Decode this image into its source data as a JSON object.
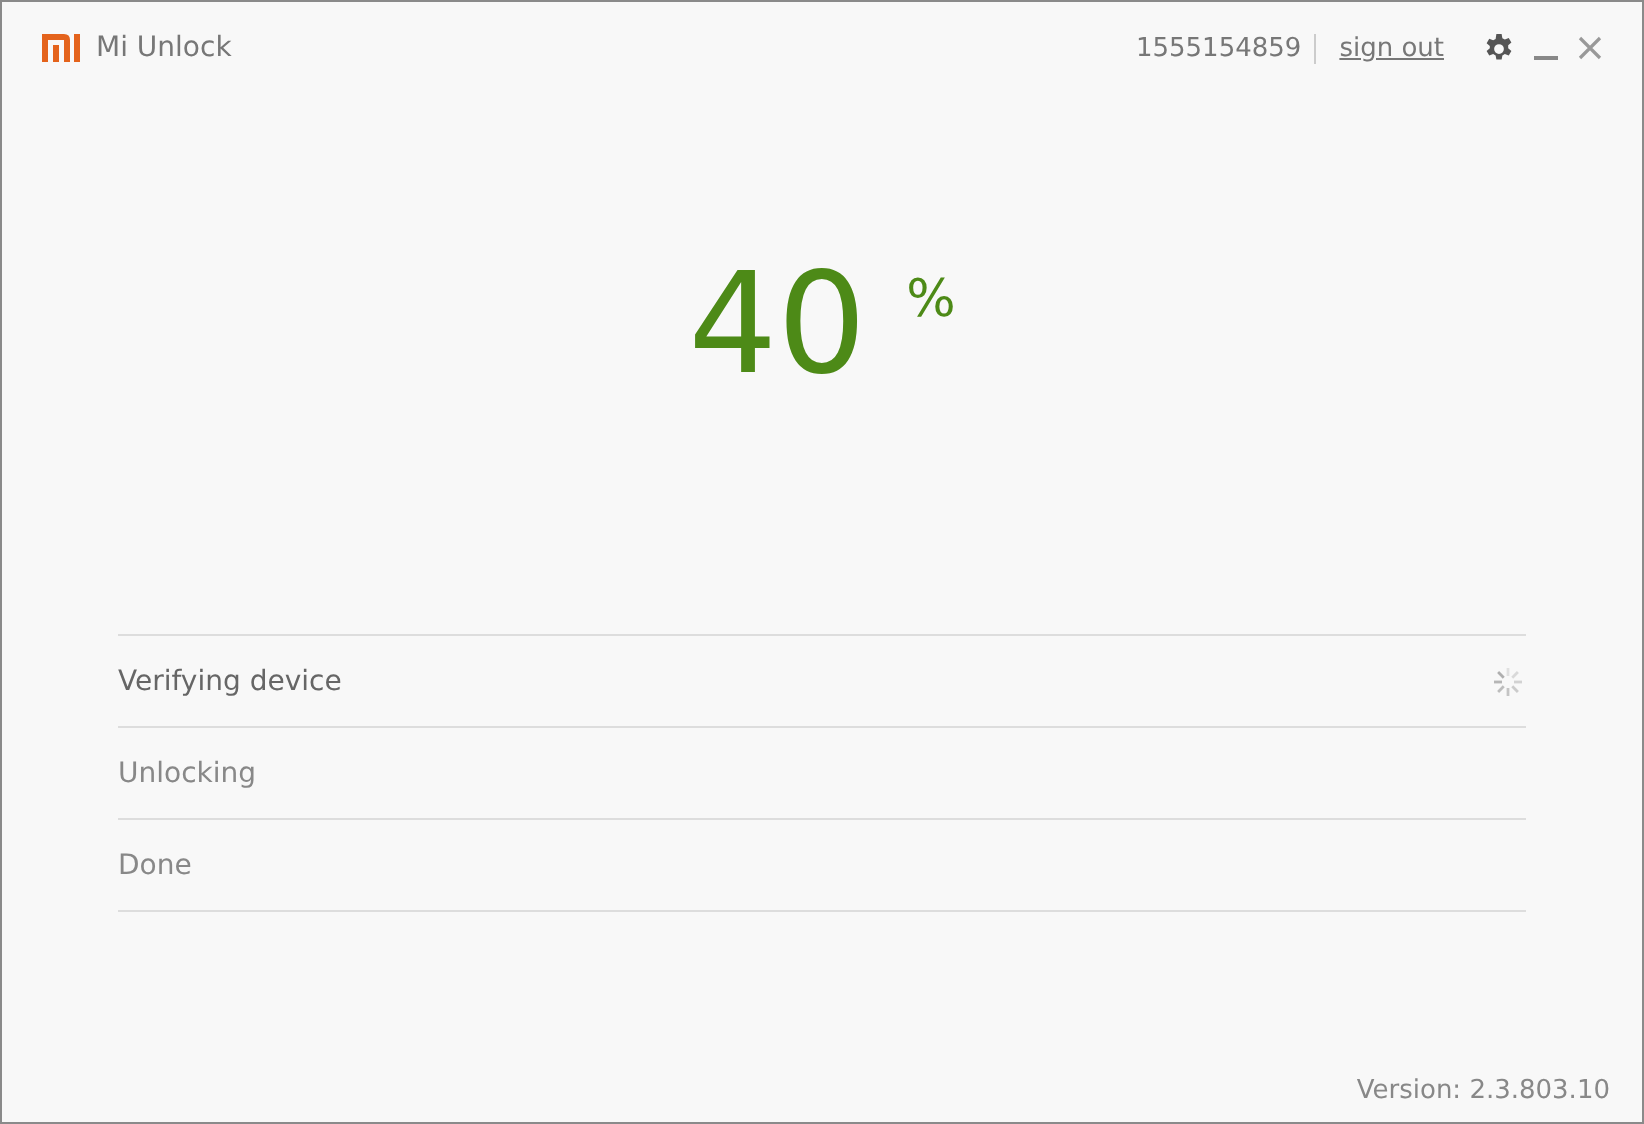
{
  "window": {
    "title": "Mi Unlock",
    "account": "1555154859",
    "sign_out": "sign out"
  },
  "progress": {
    "value": "40",
    "unit": "%"
  },
  "steps": [
    {
      "label": "Verifying device",
      "loading": true
    },
    {
      "label": "Unlocking",
      "loading": false
    },
    {
      "label": "Done",
      "loading": false
    }
  ],
  "version": "Version: 2.3.803.10"
}
